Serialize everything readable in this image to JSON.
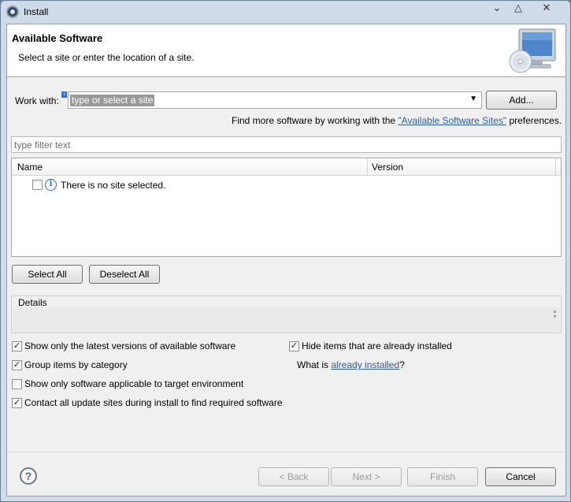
{
  "window": {
    "title": "Install",
    "min_glyph": "⌄",
    "max_glyph": "△",
    "close_glyph": "✕"
  },
  "banner": {
    "title": "Available Software",
    "subtitle": "Select a site or enter the location of a site.",
    "icon": "monitor-cd-icon"
  },
  "work_with": {
    "label": "Work with:",
    "value": "",
    "placeholder": "type or select a site",
    "add_button": "Add...",
    "info_glyph": "i"
  },
  "find_more": {
    "prefix": "Find more software by working with the ",
    "link": "\"Available Software Sites\"",
    "suffix": " preferences."
  },
  "filter": {
    "placeholder": "type filter text",
    "value": ""
  },
  "table": {
    "columns": [
      "Name",
      "Version"
    ],
    "rows": [
      {
        "name": "There is no site selected.",
        "checked": false,
        "icon": "info-icon"
      }
    ]
  },
  "select_buttons": {
    "select_all": "Select All",
    "deselect_all": "Deselect All"
  },
  "details": {
    "label": "Details"
  },
  "options": {
    "show_latest": {
      "label": "Show only the latest versions of available software",
      "checked": true
    },
    "group_by_category": {
      "label": "Group items by category",
      "checked": true
    },
    "applicable_only": {
      "label": "Show only software applicable to target environment",
      "checked": false
    },
    "contact_sites": {
      "label": "Contact all update sites during install to find required software",
      "checked": true
    },
    "hide_installed": {
      "label": "Hide items that are already installed",
      "checked": true
    },
    "what_is": {
      "prefix": "What is ",
      "link": "already installed",
      "suffix": "?"
    }
  },
  "footer": {
    "help": "?",
    "back": "< Back",
    "next": "Next >",
    "finish": "Finish",
    "cancel": "Cancel"
  },
  "colors": {
    "accent_link": "#2e5c9a",
    "info_blue": "#2a6bbf",
    "selection_gray": "#9a9a9a"
  }
}
